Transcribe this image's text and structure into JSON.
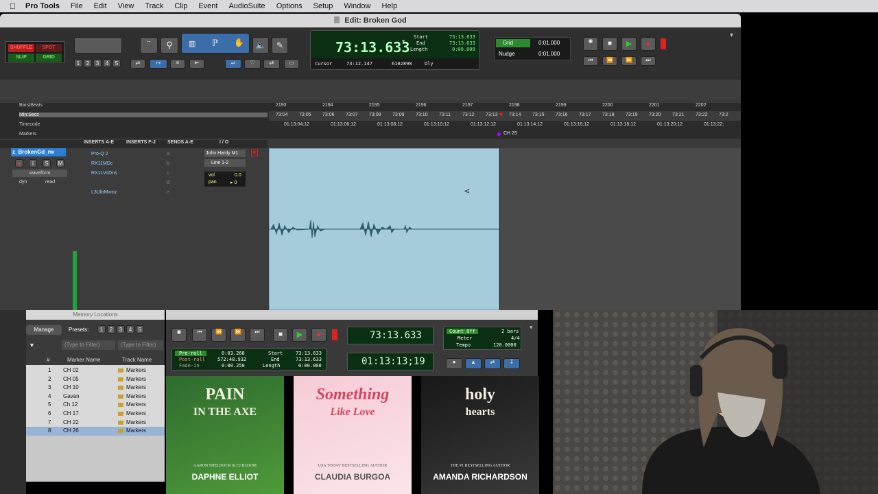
{
  "menubar": {
    "app": "Pro Tools",
    "items": [
      "File",
      "Edit",
      "View",
      "Track",
      "Clip",
      "Event",
      "AudioSuite",
      "Options",
      "Setup",
      "Window",
      "Help"
    ]
  },
  "window": {
    "title": "Edit: Broken God"
  },
  "edit_modes": {
    "shuffle": "SHUFFLE",
    "spot": "SPOT",
    "slip": "SLIP",
    "grid": "GRID"
  },
  "counter": {
    "main": "73:13.633",
    "start_label": "Start",
    "end_label": "End",
    "length_label": "Length",
    "start": "73:13.633",
    "end": "73:13.633",
    "length": "0:00.000",
    "cursor_label": "Cursor",
    "cursor": "73:12.147",
    "cursor_sample": "6102898",
    "dly": "Dly"
  },
  "grid": {
    "grid_label": "Grid",
    "grid_value": "0:01.000",
    "nudge_label": "Nudge",
    "nudge_value": "0:01.000"
  },
  "zoom_presets": [
    "1",
    "2",
    "3",
    "4",
    "5"
  ],
  "rulers": {
    "bars_label": "Bars|Beats",
    "minsecs_label": "Min:Secs",
    "timecode_label": "Timecode",
    "markers_label": "Markers",
    "bars": [
      "2193",
      "2194",
      "2195",
      "2196",
      "2197",
      "2198",
      "2199",
      "2200",
      "2201",
      "2202"
    ],
    "minsecs": [
      "73:04",
      "73:05",
      "73:06",
      "73:07",
      "73:08",
      "73:09",
      "73:10",
      "73:11",
      "73:12",
      "73:13",
      "73:14",
      "73:15",
      "73:16",
      "73:17",
      "73:18",
      "73:19",
      "73:20",
      "73:21",
      "73:22",
      "73:2"
    ],
    "timecode": [
      "01:13:04;12",
      "01:13:06;12",
      "01:13:08;12",
      "01:13:10;12",
      "01:13:12;12",
      "01:13:14;12",
      "01:13:16;12",
      "01:13:18;12",
      "01:13:20;12",
      "01:13:22;"
    ],
    "marker": "CH 25"
  },
  "mix_columns": {
    "inserts_ae": "INSERTS A-E",
    "inserts_fj": "INSERTS F-J",
    "sends": "SENDS A-E",
    "io": "I / O"
  },
  "track": {
    "name": "z_BrokenGd_rw",
    "view": "waveform",
    "dyn": "dyn",
    "auto": "read",
    "inserts": [
      "Pro-Q 2",
      "RX11MDc",
      "RX11VoDns",
      "",
      "L3UltrMxmz"
    ],
    "sends": [
      "a",
      "b",
      "c",
      "d",
      "e"
    ],
    "input": "John Hardy M1",
    "output": "Line 1-2",
    "vol_label": "vol",
    "vol": "0.0",
    "pan_label": "pan",
    "pan": "▸ 0"
  },
  "memory_locations": {
    "title": "Memory Locations",
    "manage": "Manage",
    "presets_label": "Presets:",
    "presets": [
      "1",
      "2",
      "3",
      "4",
      "5"
    ],
    "filter1": "(Type to Filter)",
    "filter2": "(Type to Filter)",
    "col_num": "#",
    "col_name": "Marker Name",
    "col_track": "Track Name",
    "rows": [
      {
        "num": "1",
        "name": "CH 02",
        "track": "Markers"
      },
      {
        "num": "2",
        "name": "CH 05",
        "track": "Markers"
      },
      {
        "num": "3",
        "name": "CH 10",
        "track": "Markers"
      },
      {
        "num": "4",
        "name": "Gavan",
        "track": "Markers"
      },
      {
        "num": "5",
        "name": "Ch 12",
        "track": "Markers"
      },
      {
        "num": "6",
        "name": "CH 17",
        "track": "Markers"
      },
      {
        "num": "7",
        "name": "CH 22",
        "track": "Markers"
      },
      {
        "num": "8",
        "name": "CH 26",
        "track": "Markers"
      }
    ]
  },
  "transport": {
    "counter1": "73:13.633",
    "counter2": "01:13:13;19",
    "preroll_label": "Pre-roll",
    "preroll": "0:03.268",
    "postroll_label": "Post-roll",
    "postroll": "572:48.932",
    "fadein_label": "Fade-in",
    "fadein": "0:00.250",
    "start_label": "Start",
    "start": "73:13.633",
    "end_label": "End",
    "end": "73:13.633",
    "length_label": "Length",
    "length": "0:00.000",
    "countoff": "Count Off",
    "countoff_value": "2 bars",
    "meter_label": "Meter",
    "meter": "4/4",
    "tempo_label": "Tempo",
    "tempo": "120.0000"
  },
  "covers": [
    {
      "title1": "PAIN",
      "title2": "IN THE AXE",
      "author": "DAPHNE ELLIOT",
      "sub": "AARON SHELDOCK & CJ BLOOM",
      "colors": [
        "#2e6b2e",
        "#4f9a3a"
      ]
    },
    {
      "title1": "Something",
      "title2": "Like Love",
      "author": "CLAUDIA BURGOA",
      "sub": "USA TODAY BESTSELLING AUTHOR",
      "colors": [
        "#f6cbd6",
        "#fbe5ea"
      ]
    },
    {
      "title1": "holy",
      "title2": "hearts",
      "author": "AMANDA RICHARDSON",
      "sub": "THE #1 BESTSELLING AUTHOR",
      "colors": [
        "#181818",
        "#3a3a3a"
      ]
    }
  ],
  "colors": {
    "accent": "#3b6ea8",
    "clip": "#a6ccdc",
    "lcd_green": "#7dff93",
    "record": "#d22"
  }
}
